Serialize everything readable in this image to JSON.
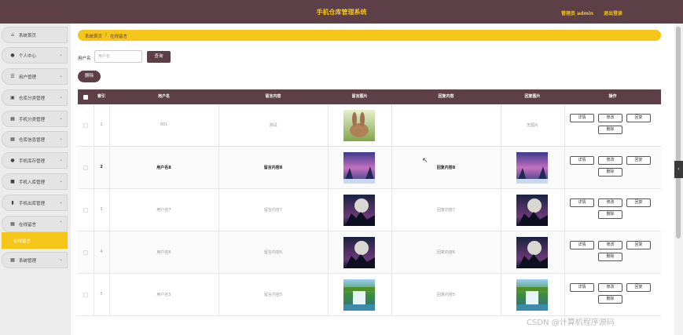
{
  "header": {
    "title": "手机仓库管理系统",
    "user": "管理员 admin",
    "logout": "退出登录"
  },
  "sidebar": {
    "items": [
      {
        "label": "系统首页",
        "icon": "home-icon"
      },
      {
        "label": "个人中心",
        "icon": "user-icon"
      },
      {
        "label": "用户管理",
        "icon": "sliders-icon"
      },
      {
        "label": "仓库分类管理",
        "icon": "cart-icon"
      },
      {
        "label": "手机分类管理",
        "icon": "grid-icon"
      },
      {
        "label": "仓库信息管理",
        "icon": "grid-icon"
      },
      {
        "label": "手机库存管理",
        "icon": "user-icon"
      },
      {
        "label": "手机入库管理",
        "icon": "video-icon"
      },
      {
        "label": "手机出库管理",
        "icon": "phone-icon"
      },
      {
        "label": "在线留言",
        "icon": "grid-icon"
      },
      {
        "label": "系统管理",
        "icon": "grid-icon"
      }
    ],
    "active_sub": "在线留言"
  },
  "breadcrumb": {
    "home": "系统首页",
    "sep": "/",
    "current": "在线留言"
  },
  "search": {
    "label": "用户名",
    "placeholder": "用户名",
    "button": "查询"
  },
  "actions": {
    "delete": "删除"
  },
  "table": {
    "columns": [
      "索引",
      "用户名",
      "留言内容",
      "留言图片",
      "回复内容",
      "回复图片",
      "操作"
    ],
    "rows": [
      {
        "index": "1",
        "username": "001",
        "content": "测试",
        "reply": "",
        "reply_image": "无图片",
        "image": "rabbit"
      },
      {
        "index": "2",
        "username": "用户名8",
        "content": "留言内容8",
        "reply": "回复内容8",
        "reply_image": "purple",
        "image": "purple"
      },
      {
        "index": "3",
        "username": "用户名7",
        "content": "留言内容7",
        "reply": "回复内容7",
        "reply_image": "moon",
        "image": "moon"
      },
      {
        "index": "4",
        "username": "用户名6",
        "content": "留言内容6",
        "reply": "回复内容6",
        "reply_image": "moon",
        "image": "moon"
      },
      {
        "index": "5",
        "username": "用户名5",
        "content": "留言内容5",
        "reply": "回复内容5",
        "reply_image": "falls",
        "image": "falls"
      }
    ],
    "buttons": {
      "detail": "详情",
      "edit": "修改",
      "reply": "回复",
      "delete": "删除"
    }
  },
  "watermark": "CSDN @计算机程序源码",
  "colors": {
    "primary": "#5c3f47",
    "accent": "#f5c518"
  }
}
